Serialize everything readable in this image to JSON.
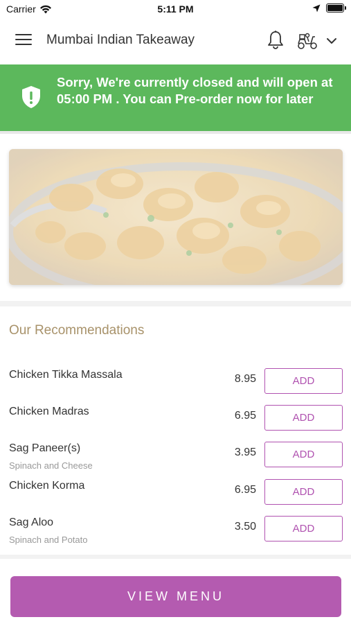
{
  "status_bar": {
    "carrier": "Carrier",
    "time": "5:11 PM"
  },
  "header": {
    "title": "Mumbai Indian Takeaway",
    "icons": [
      "menu-icon",
      "bell-icon",
      "scooter-icon",
      "chevron-down-icon"
    ]
  },
  "banner": {
    "message": "Sorry, We're currently closed and will open at 05:00 PM . You can Pre-order now for later",
    "color": "#5cb85c",
    "icon": "shield-alert-icon"
  },
  "hero": {
    "icon": "food-image"
  },
  "recommendations": {
    "title": "Our Recommendations",
    "items": [
      {
        "name": "Chicken Tikka Massala",
        "description": "",
        "price": "8.95",
        "button": "ADD"
      },
      {
        "name": "Chicken Madras",
        "description": "",
        "price": "6.95",
        "button": "ADD"
      },
      {
        "name": "Sag Paneer(s)",
        "description": "Spinach and Cheese",
        "price": "3.95",
        "button": "ADD"
      },
      {
        "name": "Chicken Korma",
        "description": "",
        "price": "6.95",
        "button": "ADD"
      },
      {
        "name": "Sag Aloo",
        "description": "Spinach and Potato",
        "price": "3.50",
        "button": "ADD"
      }
    ]
  },
  "footer": {
    "view_menu_label": "VIEW MENU",
    "accent_color": "#b45bb0"
  }
}
